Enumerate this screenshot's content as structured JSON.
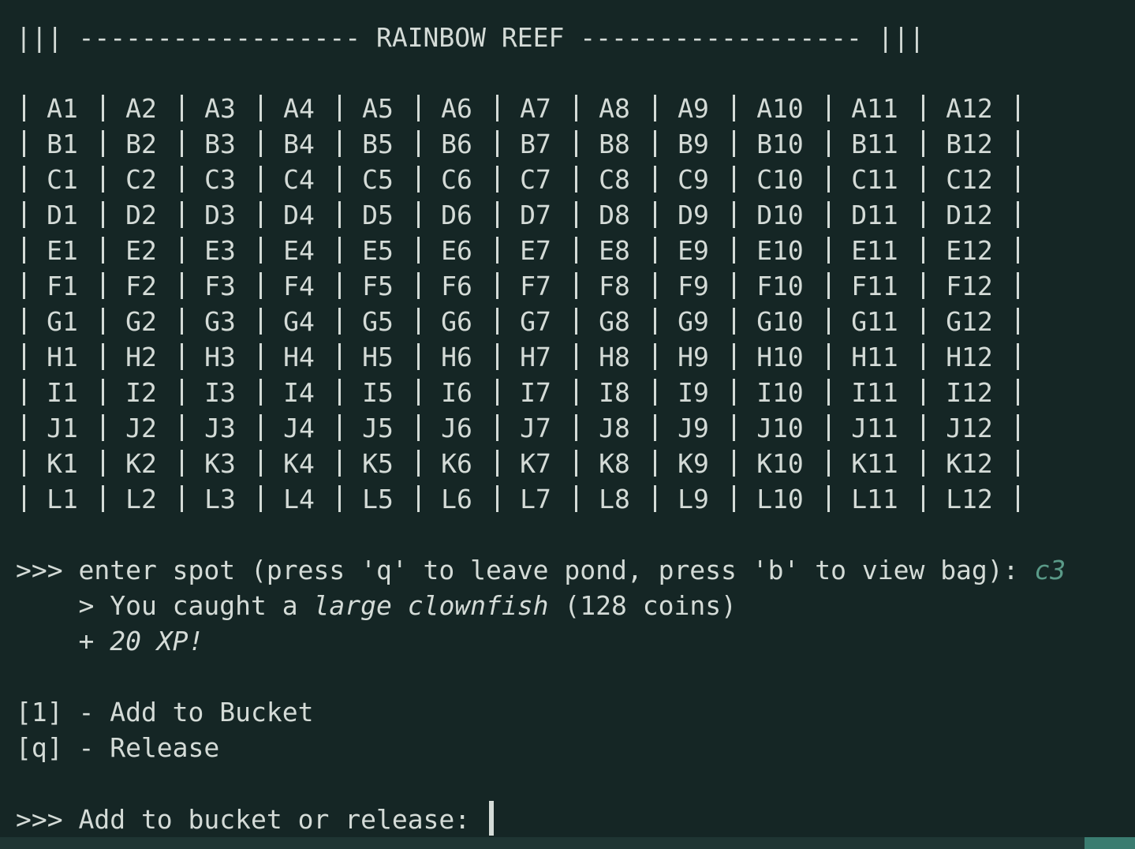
{
  "header": {
    "title": "||| ------------------ RAINBOW REEF ------------------ |||"
  },
  "grid": {
    "rows": [
      [
        "A1",
        "A2",
        "A3",
        "A4",
        "A5",
        "A6",
        "A7",
        "A8",
        "A9",
        "A10",
        "A11",
        "A12"
      ],
      [
        "B1",
        "B2",
        "B3",
        "B4",
        "B5",
        "B6",
        "B7",
        "B8",
        "B9",
        "B10",
        "B11",
        "B12"
      ],
      [
        "C1",
        "C2",
        "C3",
        "C4",
        "C5",
        "C6",
        "C7",
        "C8",
        "C9",
        "C10",
        "C11",
        "C12"
      ],
      [
        "D1",
        "D2",
        "D3",
        "D4",
        "D5",
        "D6",
        "D7",
        "D8",
        "D9",
        "D10",
        "D11",
        "D12"
      ],
      [
        "E1",
        "E2",
        "E3",
        "E4",
        "E5",
        "E6",
        "E7",
        "E8",
        "E9",
        "E10",
        "E11",
        "E12"
      ],
      [
        "F1",
        "F2",
        "F3",
        "F4",
        "F5",
        "F6",
        "F7",
        "F8",
        "F9",
        "F10",
        "F11",
        "F12"
      ],
      [
        "G1",
        "G2",
        "G3",
        "G4",
        "G5",
        "G6",
        "G7",
        "G8",
        "G9",
        "G10",
        "G11",
        "G12"
      ],
      [
        "H1",
        "H2",
        "H3",
        "H4",
        "H5",
        "H6",
        "H7",
        "H8",
        "H9",
        "H10",
        "H11",
        "H12"
      ],
      [
        "I1",
        "I2",
        "I3",
        "I4",
        "I5",
        "I6",
        "I7",
        "I8",
        "I9",
        "I10",
        "I11",
        "I12"
      ],
      [
        "J1",
        "J2",
        "J3",
        "J4",
        "J5",
        "J6",
        "J7",
        "J8",
        "J9",
        "J10",
        "J11",
        "J12"
      ],
      [
        "K1",
        "K2",
        "K3",
        "K4",
        "K5",
        "K6",
        "K7",
        "K8",
        "K9",
        "K10",
        "K11",
        "K12"
      ],
      [
        "L1",
        "L2",
        "L3",
        "L4",
        "L5",
        "L6",
        "L7",
        "L8",
        "L9",
        "L10",
        "L11",
        "L12"
      ]
    ]
  },
  "prompt1": {
    "text": ">>> enter spot (press 'q' to leave pond, press 'b' to view bag): ",
    "input": "c3"
  },
  "result": {
    "prefix": "    > You caught a ",
    "fish": "large clownfish",
    "suffix": " (128 coins)",
    "xp": "    + 20 XP!"
  },
  "options": [
    "[1] - Add to Bucket",
    "[q] - Release"
  ],
  "prompt2": {
    "text": ">>> Add to bucket or release: "
  },
  "colors": {
    "background": "#152625",
    "foreground": "#d4dbd7",
    "accent": "#5a9a88",
    "statusbar": "#1f3533",
    "statusbar_tab": "#3a7c70"
  }
}
